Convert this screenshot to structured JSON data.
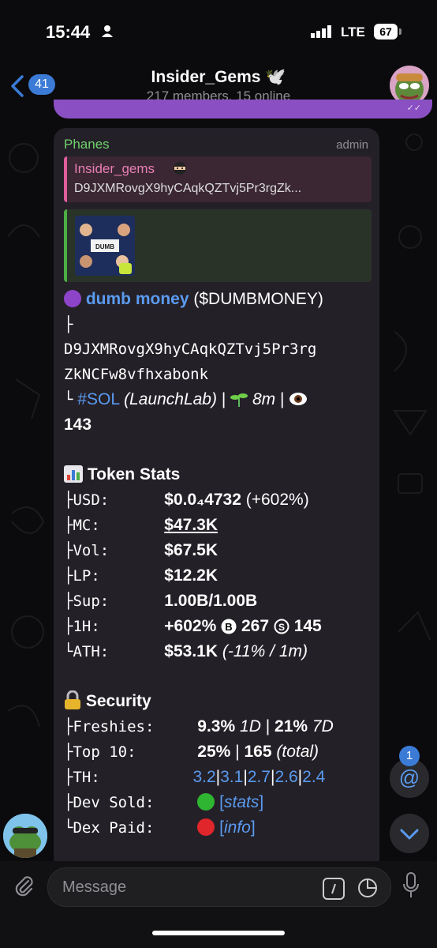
{
  "status": {
    "time": "15:44",
    "network": "LTE",
    "battery": "67"
  },
  "header": {
    "back_count": "41",
    "title": "Insider_Gems 🕊️",
    "subtitle": "217 members, 15 online"
  },
  "message": {
    "sender": "Phanes",
    "role": "admin",
    "reply": {
      "title": "Insider_gems",
      "text": "D9JXMRovgX9hyCAqkQZTvj5Pr3rgZk..."
    },
    "token": {
      "name": "dumb money",
      "ticker": "($DUMBMONEY)",
      "branch_top": "├",
      "address_1": "D9JXMRovgX9hyCAqkQZTvj5Pr3rg",
      "address_2": "ZkNCFw8vfhxabonk",
      "chain_prefix": "└",
      "chain": "#SOL",
      "platform": "(LaunchLab)",
      "age": "8m",
      "views": "143",
      "sep": "|"
    },
    "token_stats": {
      "title": "Token Stats",
      "rows": [
        {
          "prefix": "├",
          "label": "USD:",
          "value": "$0.0₄4732",
          "extra": "(+602%)"
        },
        {
          "prefix": "├",
          "label": "MC:",
          "value": "$47.3K"
        },
        {
          "prefix": "├",
          "label": "Vol:",
          "value": "$67.5K"
        },
        {
          "prefix": "├",
          "label": "LP:",
          "value": "$12.2K"
        },
        {
          "prefix": "├",
          "label": "Sup:",
          "value": "1.00B/1.00B"
        },
        {
          "prefix": "├",
          "label": "1H:",
          "value": "+602%",
          "buys": "267",
          "sells": "145"
        },
        {
          "prefix": "└",
          "label": "ATH:",
          "value": "$53.1K",
          "extra": "(-11% / 1m)"
        }
      ]
    },
    "security": {
      "title": "Security",
      "freshies": {
        "prefix": "├",
        "label": "Freshies:",
        "v1": "9.3%",
        "p1": "1D",
        "sep": "|",
        "v2": "21%",
        "p2": "7D"
      },
      "top10": {
        "prefix": "├",
        "label": "Top 10:",
        "v1": "25%",
        "sep": "|",
        "v2": "165",
        "note": "(total)"
      },
      "th": {
        "prefix": "├",
        "label": "TH:",
        "values": [
          "3.2",
          "3.1",
          "2.7",
          "2.6",
          "2.4"
        ],
        "sep": "|"
      },
      "dev_sold": {
        "prefix": "├",
        "label": "Dev Sold:",
        "link": "stats",
        "open": "[",
        "close": "]",
        "color": "#2fb531"
      },
      "dex_paid": {
        "prefix": "└",
        "label": "Dex Paid:",
        "link": "info",
        "open": "[",
        "close": "]",
        "color": "#e0262b"
      }
    }
  },
  "mention_count": "1",
  "input": {
    "placeholder": "Message"
  },
  "colors": {
    "accent": "#3b7bd6",
    "sender": "#6fd36b",
    "link": "#5a9bf0",
    "bubble": "#242028"
  }
}
